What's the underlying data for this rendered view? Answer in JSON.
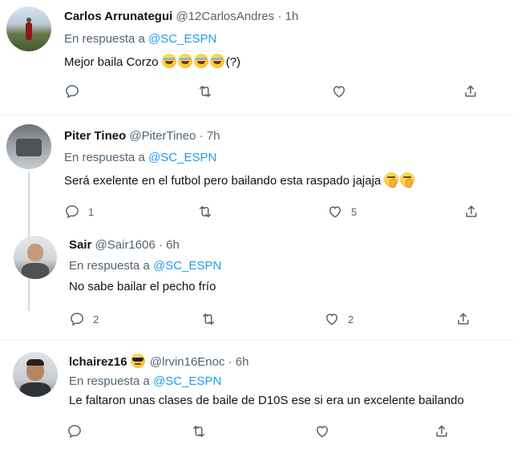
{
  "tweets": [
    {
      "name": "Carlos Arrunategui",
      "handle": "@12CarlosAndres",
      "sep": "·",
      "time": "1h",
      "reply_prefix": "En respuesta a",
      "reply_to": "@SC_ESPN",
      "text": "Mejor baila Corzo",
      "text_suffix": "(?)",
      "emojis": [
        "rolling-on-floor-laughing",
        "rolling-on-floor-laughing",
        "rolling-on-floor-laughing",
        "rolling-on-floor-laughing"
      ],
      "reply_count": "",
      "like_count": ""
    },
    {
      "name": "Piter Tineo",
      "handle": "@PiterTineo",
      "sep": "·",
      "time": "7h",
      "reply_prefix": "En respuesta a",
      "reply_to": "@SC_ESPN",
      "text": "Será exelente en el futbol pero bailando esta raspado  jajaja",
      "emojis": [
        "shushing-face",
        "shushing-face"
      ],
      "reply_count": "1",
      "like_count": "5"
    },
    {
      "name": "Sair",
      "handle": "@Sair1606",
      "sep": "·",
      "time": "6h",
      "reply_prefix": "En respuesta a",
      "reply_to": "@SC_ESPN",
      "text": "No sabe bailar el pecho frío",
      "reply_count": "2",
      "like_count": "2"
    },
    {
      "name": "lchairez16",
      "name_emoji": "smiling-face-with-sunglasses",
      "handle": "@lrvin16Enoc",
      "sep": "·",
      "time": "6h",
      "reply_prefix": "En respuesta a",
      "reply_to": "@SC_ESPN",
      "text": "Le faltaron unas clases de baile de D10S  ese si era un excelente bailando",
      "reply_count": "",
      "like_count": ""
    }
  ],
  "icons": {
    "reply": "reply-icon",
    "retweet": "retweet-icon",
    "like": "heart-icon",
    "share": "share-icon"
  },
  "colors": {
    "link": "#1d9bf0",
    "secondary_text": "#536471",
    "primary_text": "#0f1419",
    "divider": "#eff3f4"
  }
}
